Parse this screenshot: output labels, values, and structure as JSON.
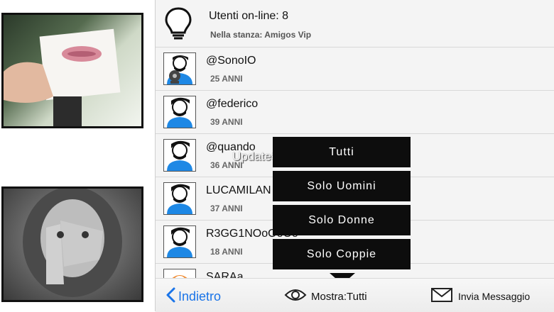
{
  "header": {
    "online_label": "Utenti on-line: 8",
    "room_label": "Nella stanza: Amigos Vip"
  },
  "users": [
    {
      "name": "@SonoIO",
      "age": "25 ANNI",
      "avatar": "webcam-avatar-icon"
    },
    {
      "name": "@federico",
      "age": "39 ANNI",
      "avatar": "male-avatar-icon"
    },
    {
      "name": "@quando",
      "age": "36 ANNI",
      "avatar": "male-avatar-icon"
    },
    {
      "name": "LUCAMILAN",
      "age": "37 ANNI",
      "avatar": "male-avatar-icon"
    },
    {
      "name": "R3GG1NOoOoOo",
      "age": "18 ANNI",
      "avatar": "male-avatar-icon"
    },
    {
      "name": "SARAa",
      "age": "",
      "avatar": "female-avatar-icon"
    }
  ],
  "watermark": "UpdateStar.com",
  "filter_menu": {
    "options": [
      "Tutti",
      "Solo Uomini",
      "Solo Donne",
      "Solo Coppie"
    ]
  },
  "bottom_bar": {
    "back_label": "Indietro",
    "show_label": "Mostra:Tutti",
    "send_label": "Invia Messaggio"
  },
  "colors": {
    "accent": "#1a74e8",
    "avatar_shirt": "#1e88e5",
    "menu_bg": "#0d0d0d"
  }
}
